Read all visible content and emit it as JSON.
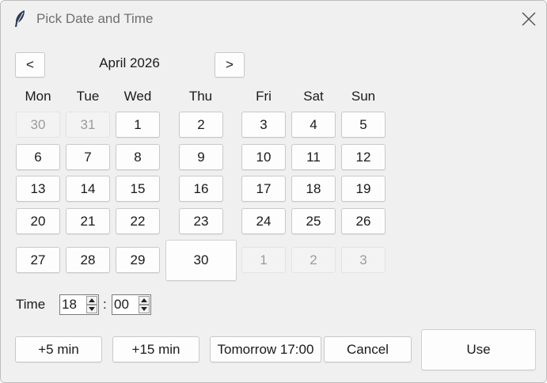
{
  "window": {
    "title": "Pick Date and Time"
  },
  "calendar": {
    "prev_label": "<",
    "next_label": ">",
    "month_label": "April 2026",
    "weekdays": [
      "Mon",
      "Tue",
      "Wed",
      "Thu",
      "Fri",
      "Sat",
      "Sun"
    ],
    "weeks": [
      [
        "30",
        "31",
        "1",
        "2",
        "3",
        "4",
        "5"
      ],
      [
        "6",
        "7",
        "8",
        "9",
        "10",
        "11",
        "12"
      ],
      [
        "13",
        "14",
        "15",
        "16",
        "17",
        "18",
        "19"
      ],
      [
        "20",
        "21",
        "22",
        "23",
        "24",
        "25",
        "26"
      ],
      [
        "27",
        "28",
        "29",
        "30",
        "1",
        "2",
        "3"
      ]
    ],
    "selected_day": "30"
  },
  "time": {
    "label": "Time",
    "hour": "18",
    "separator": ":",
    "minute": "00"
  },
  "actions": {
    "plus5": "+5 min",
    "plus15": "+15 min",
    "tomorrow": "Tomorrow 17:00",
    "cancel": "Cancel",
    "use": "Use"
  },
  "icons": {
    "app": "feather-icon",
    "close": "close-icon",
    "spin": "spin-arrows-icon"
  },
  "colors": {
    "background": "#f0f0f0",
    "button": "#fdfdfd",
    "disabled_text": "#9b9b9b",
    "title_text": "#707070"
  }
}
